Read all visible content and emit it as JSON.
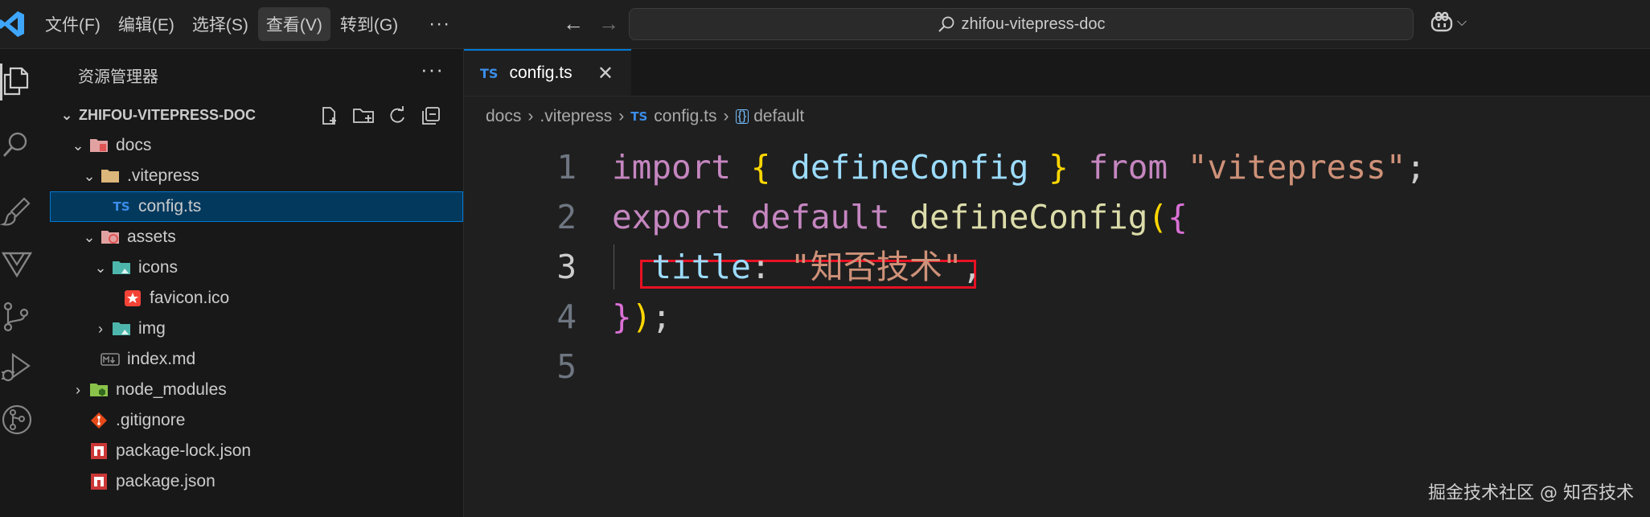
{
  "titlebar": {
    "menu": [
      "文件(F)",
      "编辑(E)",
      "选择(S)",
      "查看(V)",
      "转到(G)"
    ],
    "active_menu_index": 3,
    "more": "···",
    "back": "←",
    "forward": "→",
    "search_text": "zhifou-vitepress-doc",
    "copilot_chevron": "⌵"
  },
  "activitybar": {
    "icons": [
      "explorer-icon",
      "search-icon",
      "extensions-paint-icon",
      "vue-icon",
      "source-control-icon",
      "run-debug-icon",
      "git-graph-icon"
    ]
  },
  "sidebar": {
    "header": "资源管理器",
    "more": "···",
    "root": "ZHIFOU-VITEPRESS-DOC",
    "root_actions": [
      "new-file-icon",
      "new-folder-icon",
      "refresh-icon",
      "collapse-all-icon"
    ],
    "tree": [
      {
        "label": "docs",
        "depth": 1,
        "twistie": "open",
        "icon": "folder-docs-icon"
      },
      {
        "label": ".vitepress",
        "depth": 2,
        "twistie": "open",
        "icon": "folder-icon"
      },
      {
        "label": "config.ts",
        "depth": 3,
        "twistie": "none",
        "icon": "ts-icon",
        "selected": true
      },
      {
        "label": "assets",
        "depth": 2,
        "twistie": "open",
        "icon": "folder-assets-icon"
      },
      {
        "label": "icons",
        "depth": 3,
        "twistie": "open",
        "icon": "folder-images-icon"
      },
      {
        "label": "favicon.ico",
        "depth": 4,
        "twistie": "none",
        "icon": "favicon-icon"
      },
      {
        "label": "img",
        "depth": 3,
        "twistie": "closed",
        "icon": "folder-images-icon"
      },
      {
        "label": "index.md",
        "depth": 2,
        "twistie": "none",
        "icon": "markdown-icon"
      },
      {
        "label": "node_modules",
        "depth": 1,
        "twistie": "closed",
        "icon": "folder-node-icon"
      },
      {
        "label": ".gitignore",
        "depth": 1,
        "twistie": "none",
        "icon": "git-icon"
      },
      {
        "label": "package-lock.json",
        "depth": 1,
        "twistie": "none",
        "icon": "npm-icon"
      },
      {
        "label": "package.json",
        "depth": 1,
        "twistie": "none",
        "icon": "npm-icon"
      }
    ]
  },
  "editor": {
    "tab": {
      "label": "config.ts",
      "icon": "TS",
      "close": "✕"
    },
    "breadcrumb": [
      "docs",
      ".vitepress",
      "config.ts",
      "default"
    ],
    "breadcrumb_ts_icon": "TS",
    "breadcrumb_symbol_icon": "{}",
    "lines": [
      {
        "n": "1",
        "tokens": [
          {
            "t": "import",
            "c": "kw"
          },
          {
            "t": " ",
            "c": "punc"
          },
          {
            "t": "{",
            "c": "brace"
          },
          {
            "t": " defineConfig ",
            "c": "ident"
          },
          {
            "t": "}",
            "c": "brace"
          },
          {
            "t": " ",
            "c": "punc"
          },
          {
            "t": "from",
            "c": "kw"
          },
          {
            "t": " ",
            "c": "punc"
          },
          {
            "t": "\"vitepress\"",
            "c": "str"
          },
          {
            "t": ";",
            "c": "punc"
          }
        ]
      },
      {
        "n": "2",
        "tokens": [
          {
            "t": "export",
            "c": "kw"
          },
          {
            "t": " ",
            "c": "punc"
          },
          {
            "t": "default",
            "c": "kw"
          },
          {
            "t": " ",
            "c": "punc"
          },
          {
            "t": "defineConfig",
            "c": "fn"
          },
          {
            "t": "(",
            "c": "brace"
          },
          {
            "t": "{",
            "c": "brace2"
          }
        ]
      },
      {
        "n": "3",
        "tokens": [
          {
            "t": "  title",
            "c": "ident"
          },
          {
            "t": ": ",
            "c": "punc"
          },
          {
            "t": "\"知否技术\"",
            "c": "str"
          },
          {
            "t": ",",
            "c": "punc"
          }
        ]
      },
      {
        "n": "4",
        "tokens": [
          {
            "t": "}",
            "c": "brace2"
          },
          {
            "t": ")",
            "c": "brace"
          },
          {
            "t": ";",
            "c": "punc"
          }
        ]
      },
      {
        "n": "5",
        "tokens": []
      }
    ],
    "active_line": 3
  },
  "watermark": "掘金技术社区 @ 知否技术"
}
